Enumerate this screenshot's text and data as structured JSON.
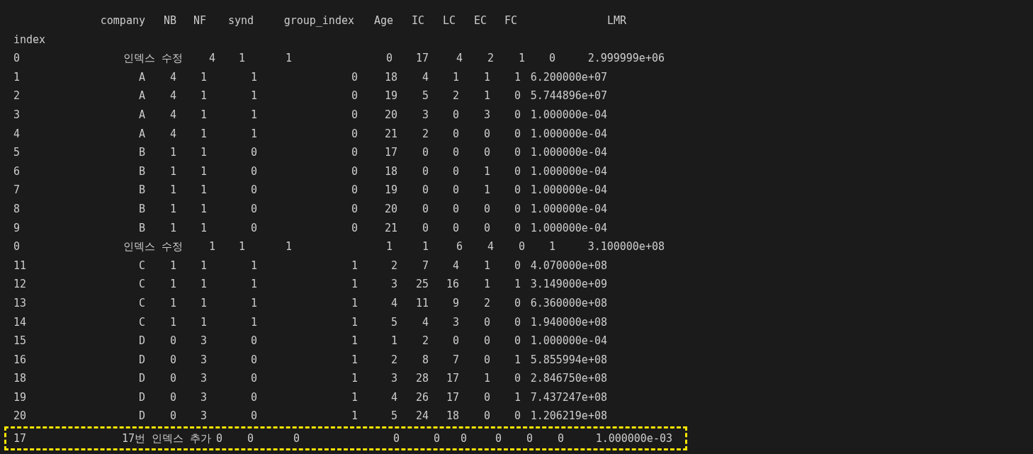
{
  "columns": [
    "company",
    "NB",
    "NF",
    "synd",
    "group_index",
    "Age",
    "IC",
    "LC",
    "EC",
    "FC",
    "LMR"
  ],
  "index_label": "index",
  "rows": [
    {
      "kind": "edited",
      "index": "0",
      "cells": [
        "인덱스 수정",
        "4",
        "1",
        "1",
        "0",
        "17",
        "4",
        "2",
        "1",
        "0",
        "2.999999e+06"
      ]
    },
    {
      "kind": "data",
      "index": "1",
      "cells": [
        "A",
        "4",
        "1",
        "1",
        "0",
        "18",
        "4",
        "1",
        "1",
        "1",
        "6.200000e+07"
      ]
    },
    {
      "kind": "data",
      "index": "2",
      "cells": [
        "A",
        "4",
        "1",
        "1",
        "0",
        "19",
        "5",
        "2",
        "1",
        "0",
        "5.744896e+07"
      ]
    },
    {
      "kind": "data",
      "index": "3",
      "cells": [
        "A",
        "4",
        "1",
        "1",
        "0",
        "20",
        "3",
        "0",
        "3",
        "0",
        "1.000000e-04"
      ]
    },
    {
      "kind": "data",
      "index": "4",
      "cells": [
        "A",
        "4",
        "1",
        "1",
        "0",
        "21",
        "2",
        "0",
        "0",
        "0",
        "1.000000e-04"
      ]
    },
    {
      "kind": "data",
      "index": "5",
      "cells": [
        "B",
        "1",
        "1",
        "0",
        "0",
        "17",
        "0",
        "0",
        "0",
        "0",
        "1.000000e-04"
      ]
    },
    {
      "kind": "data",
      "index": "6",
      "cells": [
        "B",
        "1",
        "1",
        "0",
        "0",
        "18",
        "0",
        "0",
        "1",
        "0",
        "1.000000e-04"
      ]
    },
    {
      "kind": "data",
      "index": "7",
      "cells": [
        "B",
        "1",
        "1",
        "0",
        "0",
        "19",
        "0",
        "0",
        "1",
        "0",
        "1.000000e-04"
      ]
    },
    {
      "kind": "data",
      "index": "8",
      "cells": [
        "B",
        "1",
        "1",
        "0",
        "0",
        "20",
        "0",
        "0",
        "0",
        "0",
        "1.000000e-04"
      ]
    },
    {
      "kind": "data",
      "index": "9",
      "cells": [
        "B",
        "1",
        "1",
        "0",
        "0",
        "21",
        "0",
        "0",
        "0",
        "0",
        "1.000000e-04"
      ]
    },
    {
      "kind": "edited",
      "index": "0",
      "cells": [
        "인덱스 수정",
        "1",
        "1",
        "1",
        "1",
        "1",
        "6",
        "4",
        "0",
        "1",
        "3.100000e+08"
      ]
    },
    {
      "kind": "data",
      "index": "11",
      "cells": [
        "C",
        "1",
        "1",
        "1",
        "1",
        "2",
        "7",
        "4",
        "1",
        "0",
        "4.070000e+08"
      ]
    },
    {
      "kind": "data",
      "index": "12",
      "cells": [
        "C",
        "1",
        "1",
        "1",
        "1",
        "3",
        "25",
        "16",
        "1",
        "1",
        "3.149000e+09"
      ]
    },
    {
      "kind": "data",
      "index": "13",
      "cells": [
        "C",
        "1",
        "1",
        "1",
        "1",
        "4",
        "11",
        "9",
        "2",
        "0",
        "6.360000e+08"
      ]
    },
    {
      "kind": "data",
      "index": "14",
      "cells": [
        "C",
        "1",
        "1",
        "1",
        "1",
        "5",
        "4",
        "3",
        "0",
        "0",
        "1.940000e+08"
      ]
    },
    {
      "kind": "data",
      "index": "15",
      "cells": [
        "D",
        "0",
        "3",
        "0",
        "1",
        "1",
        "2",
        "0",
        "0",
        "0",
        "1.000000e-04"
      ]
    },
    {
      "kind": "data",
      "index": "16",
      "cells": [
        "D",
        "0",
        "3",
        "0",
        "1",
        "2",
        "8",
        "7",
        "0",
        "1",
        "5.855994e+08"
      ]
    },
    {
      "kind": "data",
      "index": "18",
      "cells": [
        "D",
        "0",
        "3",
        "0",
        "1",
        "3",
        "28",
        "17",
        "1",
        "0",
        "2.846750e+08"
      ]
    },
    {
      "kind": "data",
      "index": "19",
      "cells": [
        "D",
        "0",
        "3",
        "0",
        "1",
        "4",
        "26",
        "17",
        "0",
        "1",
        "7.437247e+08"
      ]
    },
    {
      "kind": "data",
      "index": "20",
      "cells": [
        "D",
        "0",
        "3",
        "0",
        "1",
        "5",
        "24",
        "18",
        "0",
        "0",
        "1.206219e+08"
      ]
    },
    {
      "kind": "added",
      "index": "17",
      "cells": [
        "17번 인덱스 추가",
        "0",
        "0",
        "0",
        "0",
        "0",
        "0",
        "0",
        "0",
        "0",
        "1.000000e-03"
      ]
    }
  ]
}
